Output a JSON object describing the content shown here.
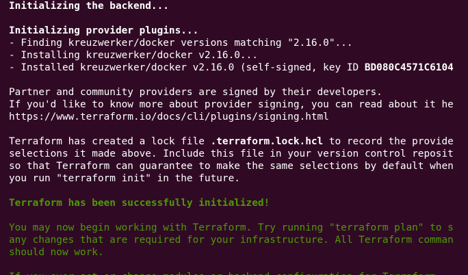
{
  "terminal": {
    "colors": {
      "background": "#300a24",
      "text": "#ffffff",
      "success": "#4e9a06"
    },
    "lines": [
      {
        "segments": [
          {
            "text": "Initializing the backend...",
            "bold": true
          }
        ]
      },
      {
        "segments": [
          {
            "text": ""
          }
        ]
      },
      {
        "segments": [
          {
            "text": "Initializing provider plugins...",
            "bold": true
          }
        ]
      },
      {
        "segments": [
          {
            "text": "- Finding kreuzwerker/docker versions matching \"2.16.0\"..."
          }
        ]
      },
      {
        "segments": [
          {
            "text": "- Installing kreuzwerker/docker v2.16.0..."
          }
        ]
      },
      {
        "segments": [
          {
            "text": "- Installed kreuzwerker/docker v2.16.0 (self-signed, key ID "
          },
          {
            "text": "BD080C4571C6104",
            "bold": true
          }
        ]
      },
      {
        "segments": [
          {
            "text": ""
          }
        ]
      },
      {
        "segments": [
          {
            "text": "Partner and community providers are signed by their developers."
          }
        ]
      },
      {
        "segments": [
          {
            "text": "If you'd like to know more about provider signing, you can read about it he"
          }
        ]
      },
      {
        "segments": [
          {
            "text": "https://www.terraform.io/docs/cli/plugins/signing.html"
          }
        ]
      },
      {
        "segments": [
          {
            "text": ""
          }
        ]
      },
      {
        "segments": [
          {
            "text": "Terraform has created a lock file "
          },
          {
            "text": ".terraform.lock.hcl",
            "bold": true
          },
          {
            "text": " to record the provide"
          }
        ]
      },
      {
        "segments": [
          {
            "text": "selections it made above. Include this file in your version control reposit"
          }
        ]
      },
      {
        "segments": [
          {
            "text": "so that Terraform can guarantee to make the same selections by default when"
          }
        ]
      },
      {
        "segments": [
          {
            "text": "you run \"terraform init\" in the future."
          }
        ]
      },
      {
        "segments": [
          {
            "text": ""
          }
        ]
      },
      {
        "segments": [
          {
            "text": "Terraform has been successfully initialized!",
            "bold": true,
            "green": true
          }
        ]
      },
      {
        "segments": [
          {
            "text": ""
          }
        ]
      },
      {
        "segments": [
          {
            "text": "You may now begin working with Terraform. Try running \"terraform plan\" to s",
            "green": true
          }
        ]
      },
      {
        "segments": [
          {
            "text": "any changes that are required for your infrastructure. All Terraform comman",
            "green": true
          }
        ]
      },
      {
        "segments": [
          {
            "text": "should now work.",
            "green": true
          }
        ]
      },
      {
        "segments": [
          {
            "text": ""
          }
        ]
      },
      {
        "segments": [
          {
            "text": "If you ever set or change modules or backend configuration for Terraform,",
            "green": true
          }
        ]
      }
    ]
  }
}
